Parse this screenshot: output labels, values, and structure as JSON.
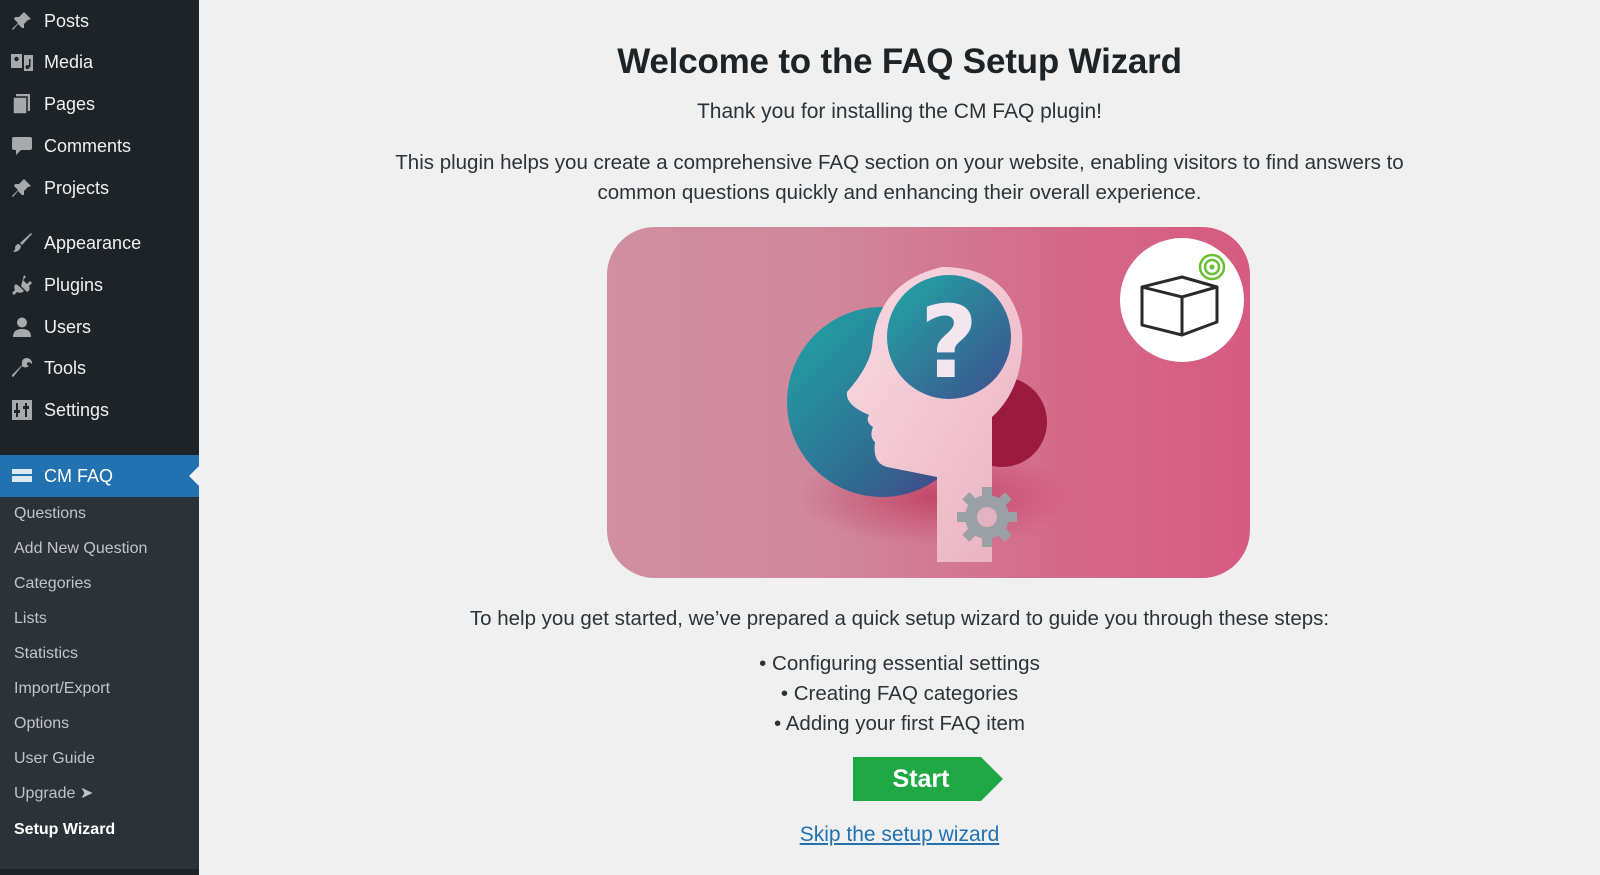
{
  "sidebar": {
    "menu": [
      {
        "label": "Posts",
        "icon": "pin-icon"
      },
      {
        "label": "Media",
        "icon": "media-icon"
      },
      {
        "label": "Pages",
        "icon": "pages-icon"
      },
      {
        "label": "Comments",
        "icon": "comment-icon"
      },
      {
        "label": "Projects",
        "icon": "pin-icon"
      },
      {
        "label": "Appearance",
        "icon": "paintbrush-icon"
      },
      {
        "label": "Plugins",
        "icon": "plug-icon"
      },
      {
        "label": "Users",
        "icon": "user-icon"
      },
      {
        "label": "Tools",
        "icon": "wrench-icon"
      },
      {
        "label": "Settings",
        "icon": "settings-icon"
      }
    ],
    "active_menu": {
      "label": "CM FAQ",
      "icon": "faq-icon"
    },
    "submenu": [
      {
        "label": "Questions"
      },
      {
        "label": "Add New Question"
      },
      {
        "label": "Categories"
      },
      {
        "label": "Lists"
      },
      {
        "label": "Statistics"
      },
      {
        "label": "Import/Export"
      },
      {
        "label": "Options"
      },
      {
        "label": "User Guide"
      },
      {
        "label": "Upgrade ➤"
      },
      {
        "label": "Setup Wizard",
        "active": true
      }
    ]
  },
  "main": {
    "title": "Welcome to the FAQ Setup Wizard",
    "subtitle": "Thank you for installing the CM FAQ plugin!",
    "description_line1": "This plugin helps you create a comprehensive FAQ section on your website, enabling visitors to find answers to",
    "description_line2": "common questions quickly and enhancing their overall experience.",
    "intro": "To help you get started, we’ve prepared a quick setup wizard to guide you through these steps:",
    "steps": [
      "• Configuring essential settings",
      "• Creating FAQ categories",
      "• Adding your first FAQ item"
    ],
    "start_label": "Start",
    "skip_label": "Skip the setup wizard"
  },
  "colors": {
    "sidebar_bg": "#1d2327",
    "submenu_bg": "#2c3338",
    "active_bg": "#2271b1",
    "start_button": "#1fa844",
    "link": "#2271b1"
  }
}
